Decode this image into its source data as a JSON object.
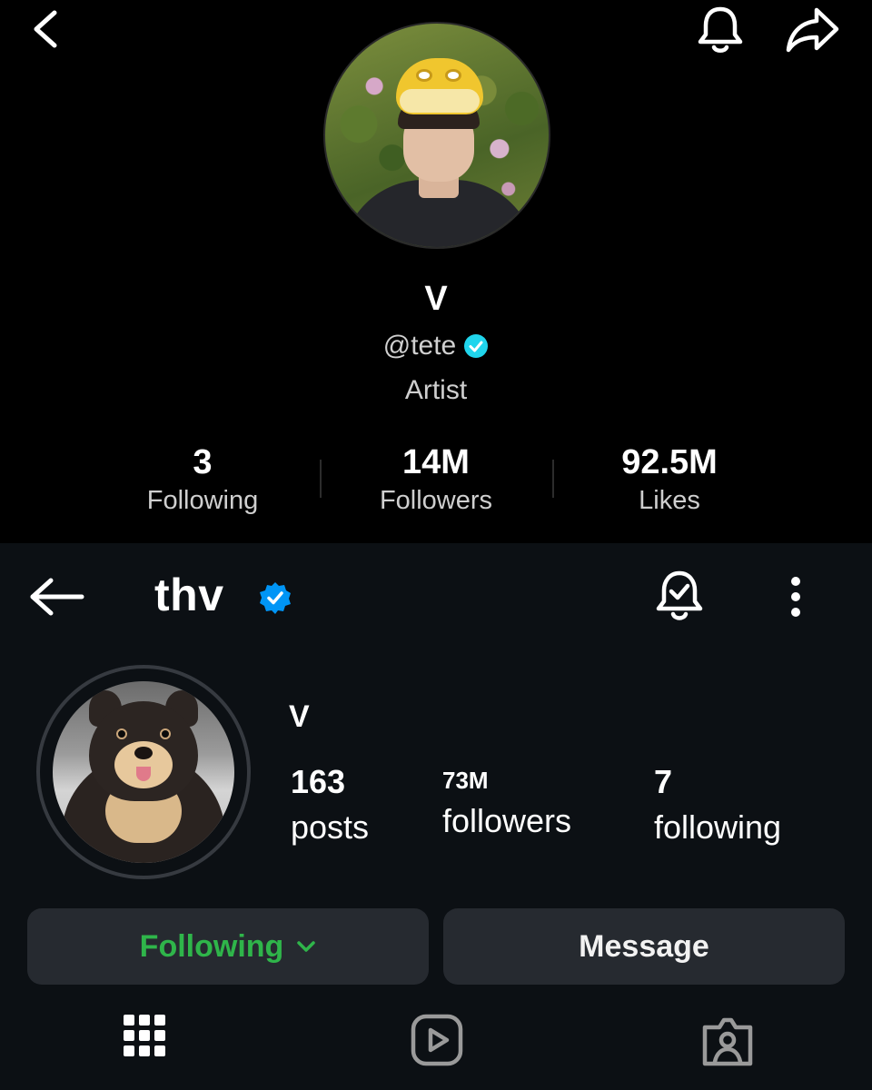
{
  "tiktok": {
    "display_name": "V",
    "handle": "@tete",
    "bio": "Artist",
    "stats": [
      {
        "value": "3",
        "label": "Following"
      },
      {
        "value": "14M",
        "label": "Followers"
      },
      {
        "value": "92.5M",
        "label": "Likes"
      }
    ],
    "icons": {
      "back": "chevron-left-icon",
      "bell": "bell-icon",
      "share": "share-icon",
      "verified": "verified-badge-icon"
    },
    "colors": {
      "background": "#000000",
      "verified": "#20d5ec"
    }
  },
  "instagram": {
    "username": "thv",
    "display_name": "V",
    "stats": [
      {
        "value": "163",
        "label": "posts"
      },
      {
        "value": "73M",
        "label": "followers"
      },
      {
        "value": "7",
        "label": "following"
      }
    ],
    "buttons": {
      "following_label": "Following",
      "message_label": "Message"
    },
    "icons": {
      "back": "arrow-left-icon",
      "verified": "verified-badge-icon",
      "bell": "notification-bell-check-icon",
      "menu": "more-vertical-icon",
      "tabs": [
        "grid-icon",
        "reels-icon",
        "tagged-icon"
      ]
    },
    "colors": {
      "background": "#0c1014",
      "button": "#262a30",
      "following": "#2fb54a",
      "verified": "#0095f6"
    }
  }
}
